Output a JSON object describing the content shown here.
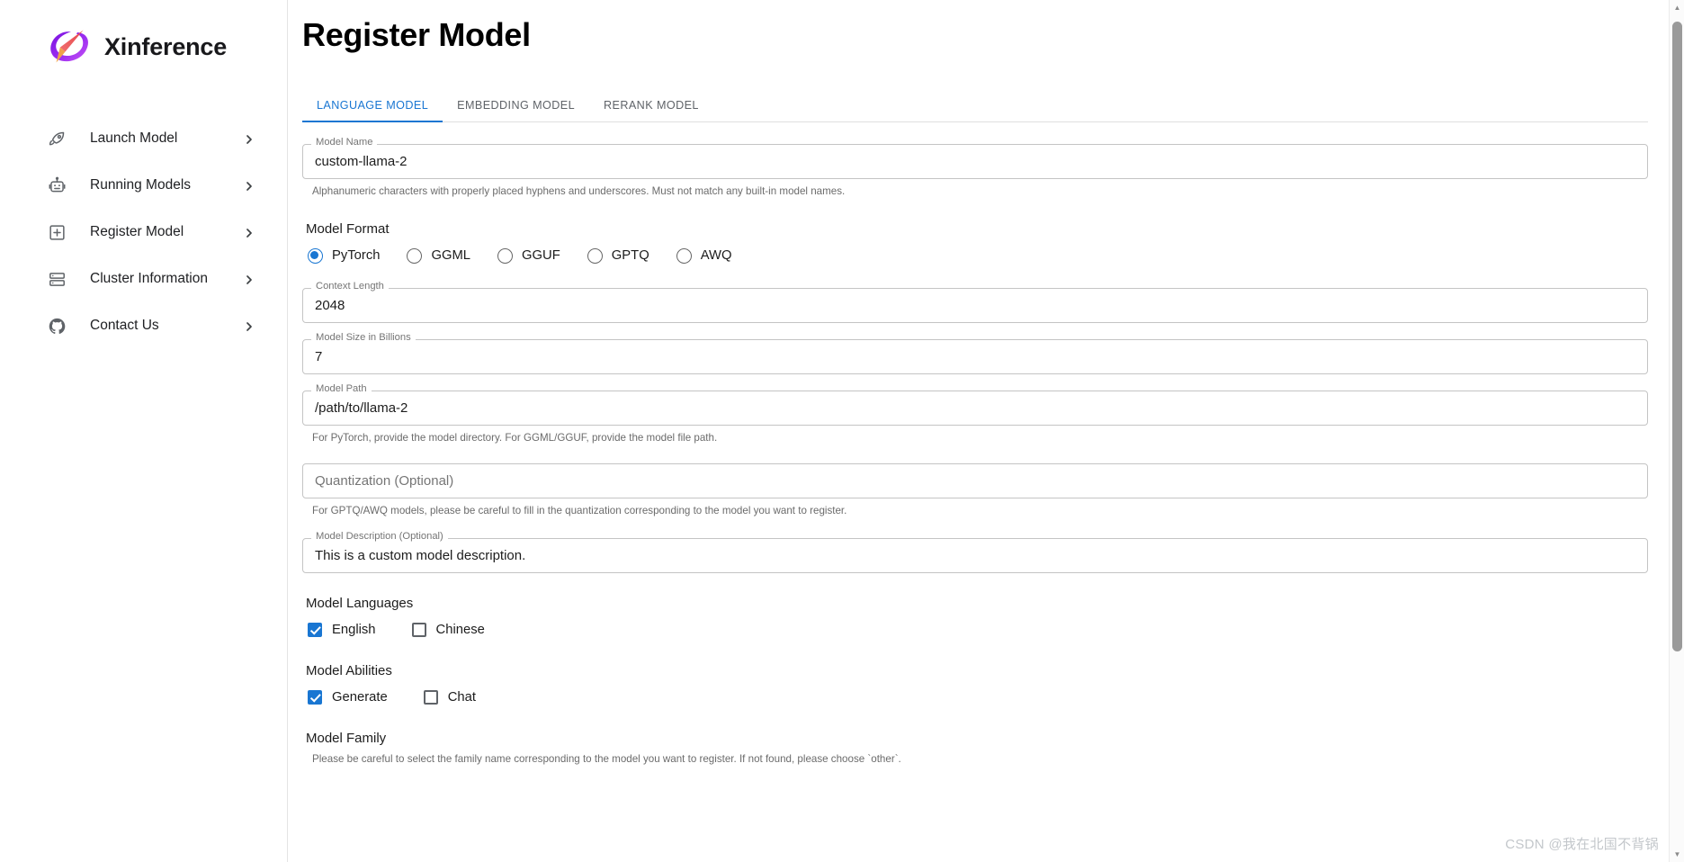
{
  "sidebar": {
    "brand": {
      "name": "Xinference",
      "logo_icon": "xinference-logo"
    },
    "items": [
      {
        "label": "Launch Model",
        "icon": "rocket-icon"
      },
      {
        "label": "Running Models",
        "icon": "robot-icon"
      },
      {
        "label": "Register Model",
        "icon": "plus-square-icon"
      },
      {
        "label": "Cluster Information",
        "icon": "server-stack-icon"
      },
      {
        "label": "Contact Us",
        "icon": "github-icon"
      }
    ],
    "chevron_icon": "chevron-right-icon"
  },
  "header": {
    "title": "Register Model"
  },
  "tabs": {
    "active_index": 0,
    "items": [
      {
        "label": "LANGUAGE MODEL"
      },
      {
        "label": "EMBEDDING MODEL"
      },
      {
        "label": "RERANK MODEL"
      }
    ]
  },
  "form": {
    "model_name": {
      "label": "Model Name",
      "value": "custom-llama-2",
      "helper": "Alphanumeric characters with properly placed hyphens and underscores. Must not match any built-in model names."
    },
    "model_format": {
      "title": "Model Format",
      "selected": "PyTorch",
      "options": [
        {
          "label": "PyTorch",
          "checked": true
        },
        {
          "label": "GGML",
          "checked": false
        },
        {
          "label": "GGUF",
          "checked": false
        },
        {
          "label": "GPTQ",
          "checked": false
        },
        {
          "label": "AWQ",
          "checked": false
        }
      ]
    },
    "context_length": {
      "label": "Context Length",
      "value": "2048"
    },
    "model_size": {
      "label": "Model Size in Billions",
      "value": "7"
    },
    "model_path": {
      "label": "Model Path",
      "value": "/path/to/llama-2",
      "helper": "For PyTorch, provide the model directory. For GGML/GGUF, provide the model file path."
    },
    "quantization": {
      "placeholder": "Quantization (Optional)",
      "value": "",
      "helper": "For GPTQ/AWQ models, please be careful to fill in the quantization corresponding to the model you want to register."
    },
    "model_description": {
      "label": "Model Description (Optional)",
      "value": "This is a custom model description."
    },
    "model_languages": {
      "title": "Model Languages",
      "options": [
        {
          "label": "English",
          "checked": true
        },
        {
          "label": "Chinese",
          "checked": false
        }
      ]
    },
    "model_abilities": {
      "title": "Model Abilities",
      "options": [
        {
          "label": "Generate",
          "checked": true
        },
        {
          "label": "Chat",
          "checked": false
        }
      ]
    },
    "model_family": {
      "title": "Model Family",
      "helper": "Please be careful to select the family name corresponding to the model you want to register. If not found, please choose `other`."
    }
  },
  "watermark": {
    "text": "CSDN @我在北国不背锅"
  },
  "colors": {
    "accent": "#1976d2",
    "text": "#1c1c1c",
    "muted": "#6b6b6b",
    "border": "#c4c4c4"
  }
}
